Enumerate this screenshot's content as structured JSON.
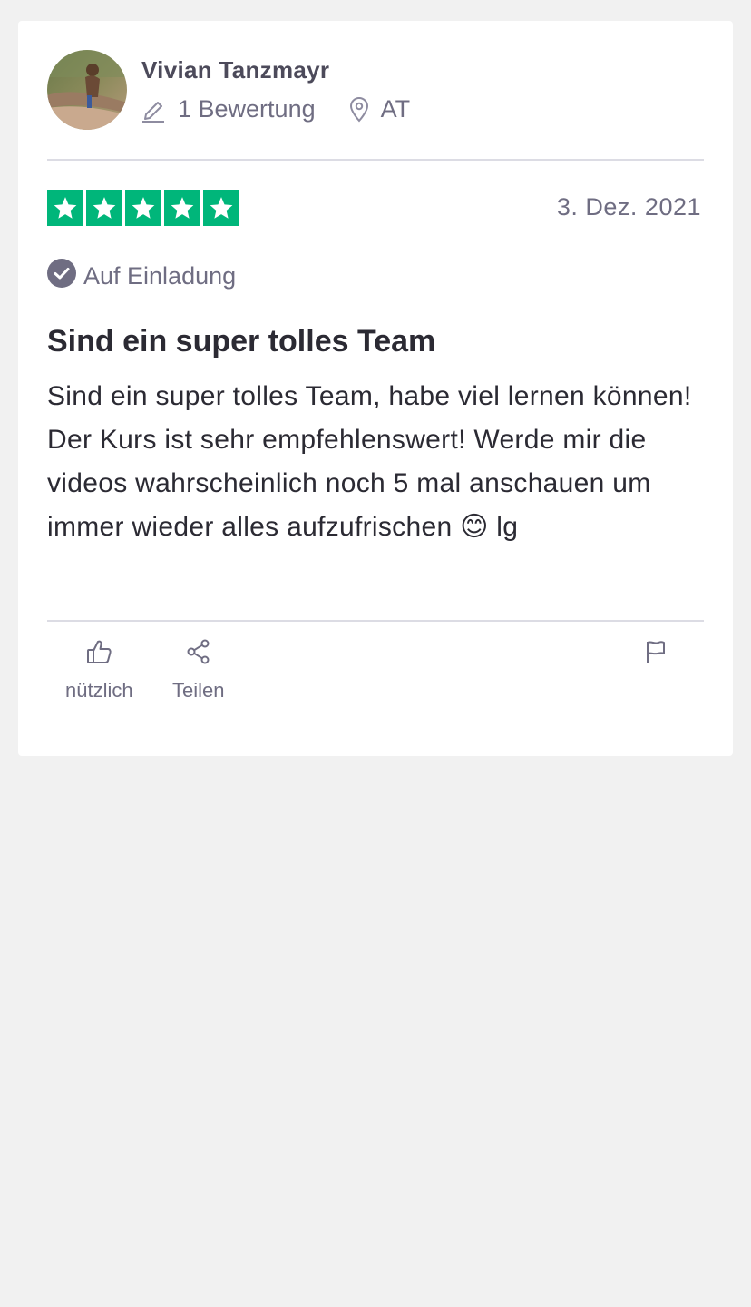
{
  "reviewer": {
    "name": "Vivian Tanzmayr",
    "reviews_count": "1 Bewertung",
    "country": "AT"
  },
  "review": {
    "rating": 5,
    "date": "3. Dez. 2021",
    "verification": "Auf Einladung",
    "title": "Sind ein super tolles Team",
    "body": "Sind ein super tolles Team, habe viel lernen können! Der Kurs ist sehr empfehlenswert! Werde mir die videos wahrscheinlich noch 5 mal anschauen um immer wieder alles aufzufrischen 😊 lg"
  },
  "actions": {
    "useful_label": "nützlich",
    "share_label": "Teilen"
  },
  "icons": {
    "reviews": "pencil-icon",
    "location": "location-pin-icon",
    "verified": "check-circle-icon",
    "useful": "thumbs-up-icon",
    "share": "share-icon",
    "report": "flag-icon"
  },
  "colors": {
    "star_green": "#00b67a",
    "muted_text": "#6f6d82",
    "body_text": "#2b2a33"
  }
}
